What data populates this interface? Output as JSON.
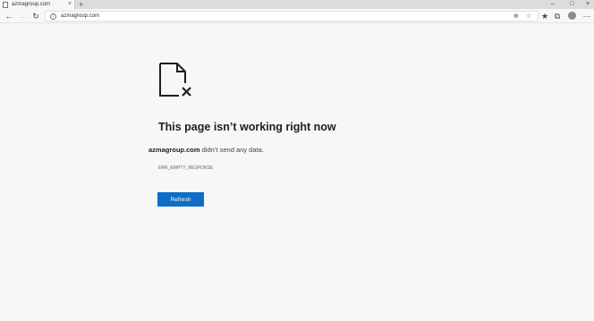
{
  "tab": {
    "title": "azmagroup.com",
    "close_glyph": "×"
  },
  "newtab_glyph": "+",
  "window_controls": {
    "minimize": "–",
    "restore": "□",
    "close": "×"
  },
  "toolbar": {
    "back_glyph": "←",
    "forward_glyph": "→",
    "reload_glyph": "↻",
    "url": "azmagroup.com",
    "info_glyph": "i"
  },
  "toolbar_icons": {
    "zoom": "⊕",
    "favorite": "☆",
    "favorites_bar": "★",
    "collections": "⧉",
    "menu": "⋯"
  },
  "error_page": {
    "heading": "This page isn’t working right now",
    "host": "azmagroup.com",
    "message": "didn’t send any data.",
    "error_code": "ERR_EMPTY_RESPONSE",
    "refresh_label": "Refresh"
  },
  "colors": {
    "accent": "#0c6ec4",
    "page_background": "#f7f7f7",
    "tabstrip": "#dcdcdc"
  }
}
